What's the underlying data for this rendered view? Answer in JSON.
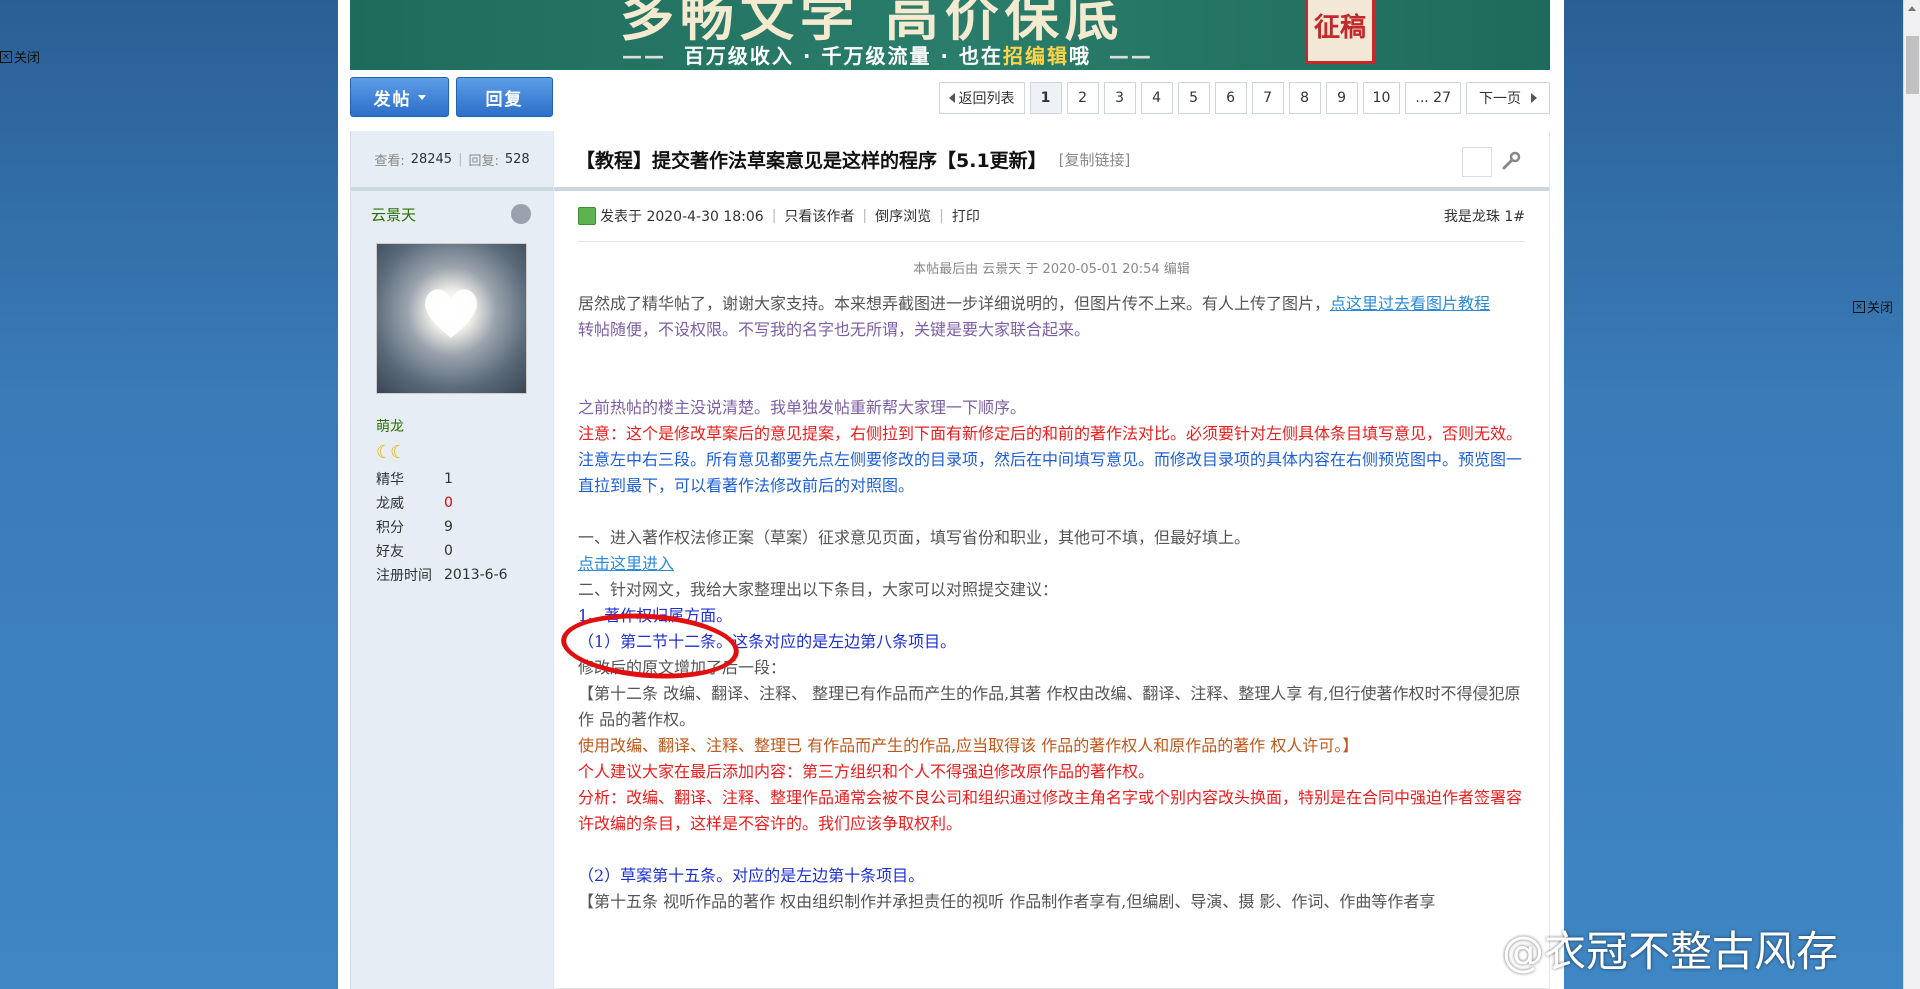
{
  "close_label": "关闭",
  "banner": {
    "headline": "多畅文学 高价保底",
    "tagline_before": "百万级收入 · 千万级流量 · 也在",
    "tagline_highlight": "招编辑",
    "tagline_after": "哦",
    "stamp": "征稿"
  },
  "toolbar": {
    "post_btn": "发帖",
    "reply_btn": "回复",
    "back_list": "返回列表",
    "pages": [
      "1",
      "2",
      "3",
      "4",
      "5",
      "6",
      "7",
      "8",
      "9",
      "10",
      "... 27"
    ],
    "current_page": "1",
    "next_page": "下一页"
  },
  "sidebar": {
    "views_label": "查看:",
    "views": "28245",
    "replies_label": "回复:",
    "replies": "528",
    "author": "云景天",
    "rank": "萌龙",
    "moons": "☾☾",
    "stats": [
      {
        "k": "精华",
        "v": "1"
      },
      {
        "k": "龙威",
        "v": "0"
      },
      {
        "k": "积分",
        "v": "9"
      },
      {
        "k": "好友",
        "v": "0"
      },
      {
        "k": "注册时间",
        "v": "2013-6-6"
      }
    ]
  },
  "post": {
    "title": "【教程】提交著作法草案意见是这样的程序【5.1更新】",
    "copy_link": "[复制链接]",
    "posted_at": "发表于 2020-4-30 18:06",
    "only_author": "只看该作者",
    "reverse": "倒序浏览",
    "print": "打印",
    "floor": "我是龙珠 1#",
    "edit_note": "本帖最后由 云景天 于 2020-05-01 20:54 编辑",
    "p1_text": "居然成了精华帖了，谢谢大家支持。本来想弄截图进一步详细说明的，但图片传不上来。有人上传了图片，",
    "p1_link": "点这里过去看图片教程",
    "p2": "转帖随便，不设权限。不写我的名字也无所谓，关键是要大家联合起来。",
    "p3": "之前热帖的楼主没说清楚。我单独发帖重新帮大家理一下顺序。",
    "p4": "注意：这个是修改草案后的意见提案，右侧拉到下面有新修定后的和前的著作法对比。必须要针对左侧具体条目填写意见，否则无效。",
    "p5": "注意左中右三段。所有意见都要先点左侧要修改的目录项，然后在中间填写意见。而修改目录项的具体内容在右侧预览图中。预览图一直拉到最下，可以看著作法修改前后的对照图。",
    "p6": "一、进入著作权法修正案（草案）征求意见页面，填写省份和职业，其他可不填，但最好填上。",
    "p6_link": "点击这里进入",
    "p7": "二、针对网文，我给大家整理出以下条目，大家可以对照提交建议：",
    "p8": "1、著作权归属方面。",
    "p9": "（1）第二节十二条。这条对应的是左边第八条项目。",
    "p10": "修改后的原文增加了后一段：",
    "p11": "【第十二条 改编、翻译、注释、 整理已有作品而产生的作品,其著 作权由改编、翻译、注释、整理人享 有,但行使著作权时不得侵犯原作 品的著作权。",
    "p12": "使用改编、翻译、注释、整理已 有作品而产生的作品,应当取得该 作品的著作权人和原作品的著作 权人许可。】",
    "p13": "个人建议大家在最后添加内容：第三方组织和个人不得强迫修改原作品的著作权。",
    "p14": "分析：改编、翻译、注释、整理作品通常会被不良公司和组织通过修改主角名字或个别内容改头换面，特别是在合同中强迫作者签署容许改编的条目，这样是不容许的。我们应该争取权利。",
    "p15": "（2）草案第十五条。对应的是左边第十条项目。",
    "p16": "【第十五条 视听作品的著作 权由组织制作并承担责任的视听 作品制作者享有,但编剧、导演、摄 影、作词、作曲等作者享"
  },
  "watermark": "@衣冠不整古风存"
}
